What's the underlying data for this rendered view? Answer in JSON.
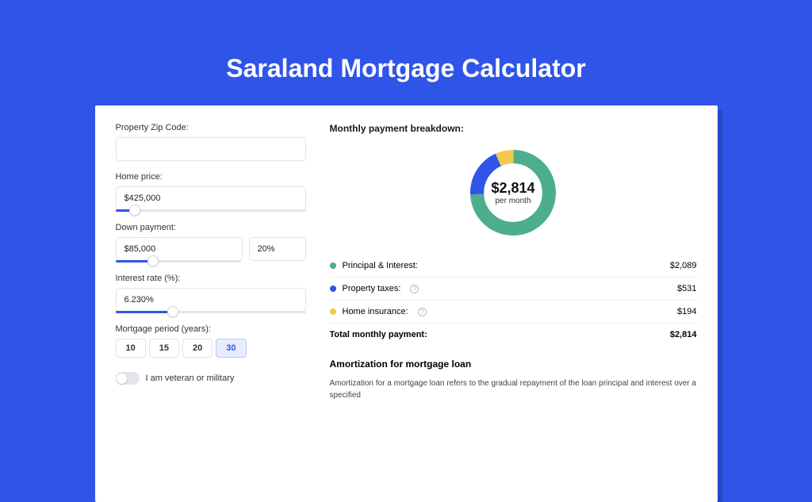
{
  "title": "Saraland Mortgage Calculator",
  "form": {
    "zip": {
      "label": "Property Zip Code:",
      "value": ""
    },
    "home_price": {
      "label": "Home price:",
      "value": "$425,000",
      "slider_pct": 10
    },
    "down_payment": {
      "label": "Down payment:",
      "value": "$85,000",
      "pct_value": "20%",
      "slider_pct": 20
    },
    "interest": {
      "label": "Interest rate (%):",
      "value": "6.230%",
      "slider_pct": 30
    },
    "period": {
      "label": "Mortgage period (years):",
      "options": [
        "10",
        "15",
        "20",
        "30"
      ],
      "selected": "30"
    },
    "veteran": {
      "label": "I am veteran or military",
      "checked": false
    }
  },
  "breakdown": {
    "title": "Monthly payment breakdown:",
    "donut": {
      "amount": "$2,814",
      "sub": "per month"
    },
    "items": [
      {
        "label": "Principal & Interest:",
        "value": "$2,089",
        "color": "#4cae8f",
        "info": false
      },
      {
        "label": "Property taxes:",
        "value": "$531",
        "color": "#2f55e8",
        "info": true
      },
      {
        "label": "Home insurance:",
        "value": "$194",
        "color": "#f2c94c",
        "info": true
      }
    ],
    "total": {
      "label": "Total monthly payment:",
      "value": "$2,814"
    }
  },
  "amort": {
    "title": "Amortization for mortgage loan",
    "text": "Amortization for a mortgage loan refers to the gradual repayment of the loan principal and interest over a specified"
  },
  "chart_data": {
    "type": "pie",
    "title": "Monthly payment breakdown",
    "series": [
      {
        "name": "Principal & Interest",
        "value": 2089,
        "color": "#4cae8f"
      },
      {
        "name": "Property taxes",
        "value": 531,
        "color": "#2f55e8"
      },
      {
        "name": "Home insurance",
        "value": 194,
        "color": "#f2c94c"
      }
    ],
    "total": 2814,
    "center_label": "$2,814 per month"
  }
}
